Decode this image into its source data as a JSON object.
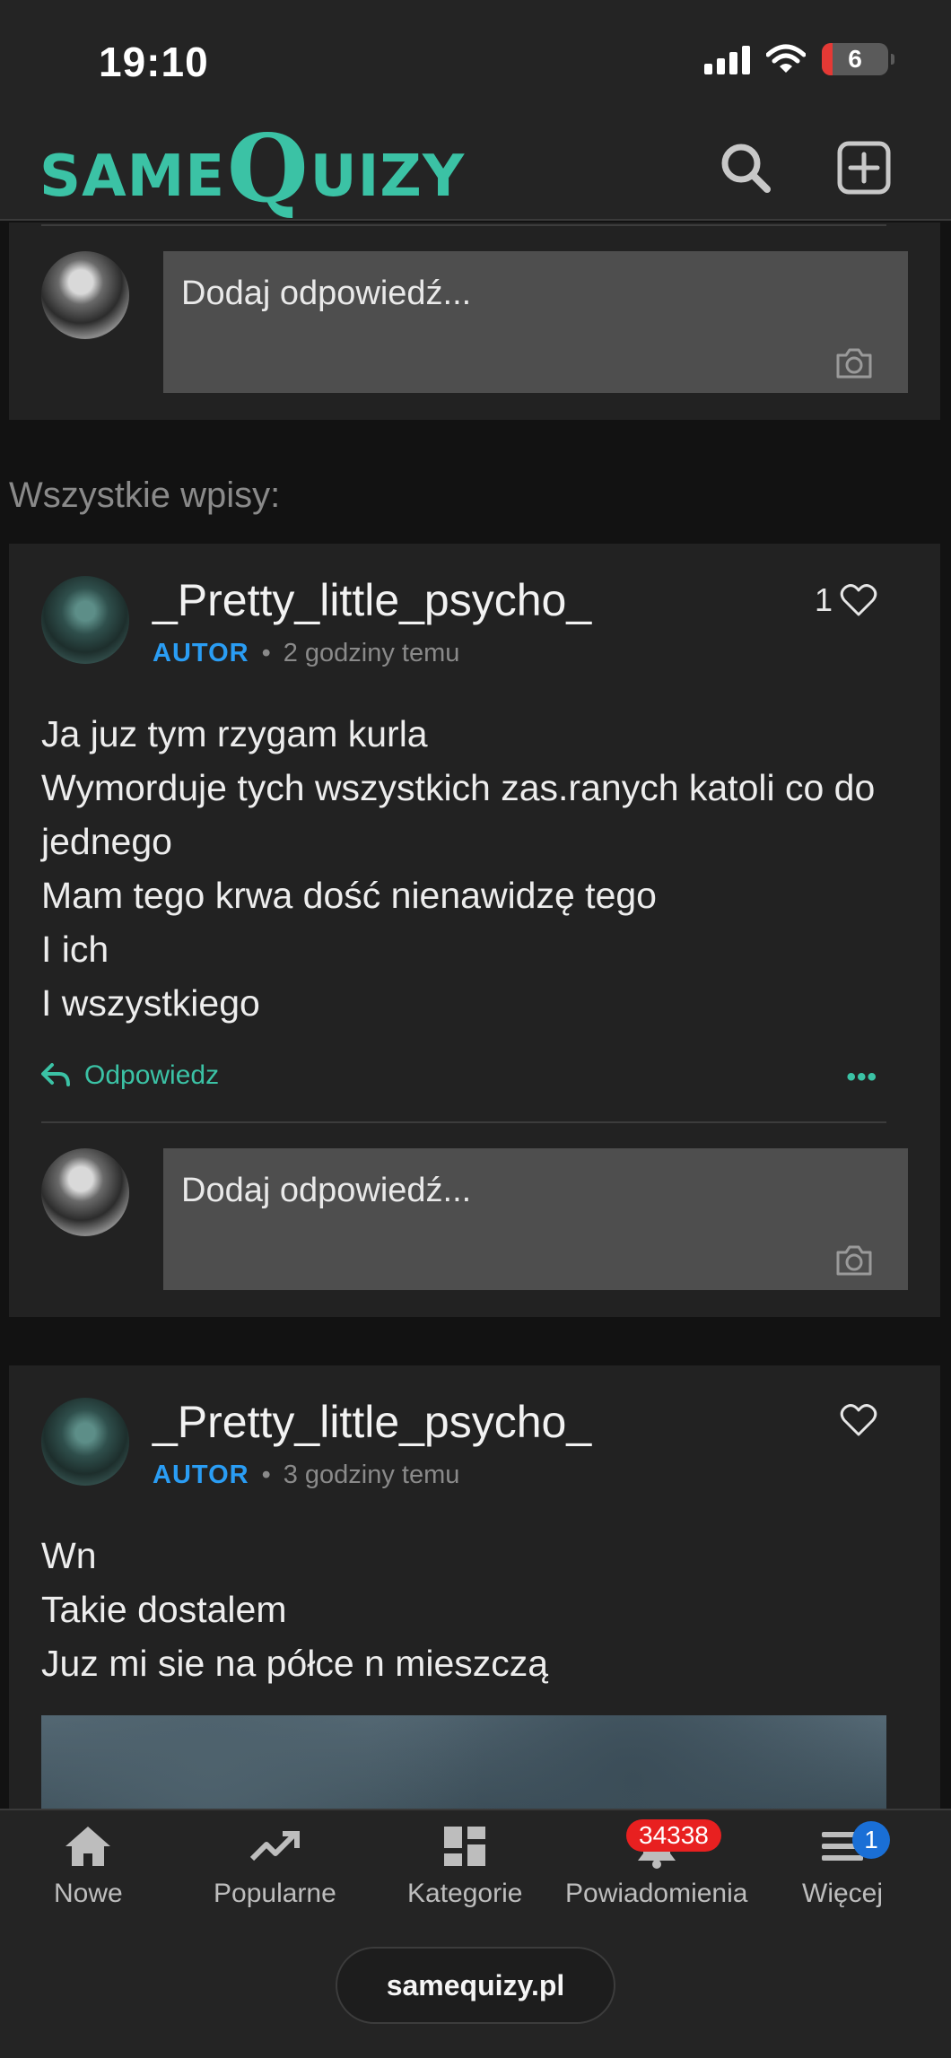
{
  "status_bar": {
    "time": "19:10",
    "battery": "6"
  },
  "header": {
    "logo_part1": "SAME",
    "logo_part2": "Q",
    "logo_part3": "UIZY",
    "search_icon": "search-icon",
    "add_icon": "plus-square-icon"
  },
  "top_reply": {
    "placeholder": "Dodaj odpowiedź..."
  },
  "section_title": "Wszystkie wpisy:",
  "posts": [
    {
      "username": "_Pretty_little_psycho_",
      "role": "AUTOR",
      "time": "2 godziny temu",
      "likes": "1",
      "lines": [
        "Ja juz tym rzygam kurla",
        "Wymorduje tych wszystkich zas.ranych katoli co do jednego",
        "Mam tego krwa dość nienawidzę tego",
        "I ich",
        "I wszystkiego"
      ],
      "reply_label": "Odpowiedz",
      "more_label": "•••",
      "reply_placeholder": "Dodaj odpowiedź..."
    },
    {
      "username": "_Pretty_little_psycho_",
      "role": "AUTOR",
      "time": "3 godziny temu",
      "likes": "",
      "lines": [
        "Wn",
        "Takie dostalem",
        "Juz mi sie na półce n mieszczą"
      ]
    }
  ],
  "tabbar": {
    "items": [
      {
        "label": "Nowe",
        "icon": "home-icon"
      },
      {
        "label": "Popularne",
        "icon": "trending-icon"
      },
      {
        "label": "Kategorie",
        "icon": "grid-icon"
      },
      {
        "label": "Powiadomienia",
        "icon": "bell-icon",
        "badge": "34338"
      },
      {
        "label": "Więcej",
        "icon": "menu-icon",
        "badge": "1"
      }
    ]
  },
  "url": "samequizy.pl",
  "colors": {
    "accent": "#3bc2a5",
    "autor": "#2a9df4",
    "badge_red": "#e82020",
    "badge_blue": "#1a6fd6"
  }
}
